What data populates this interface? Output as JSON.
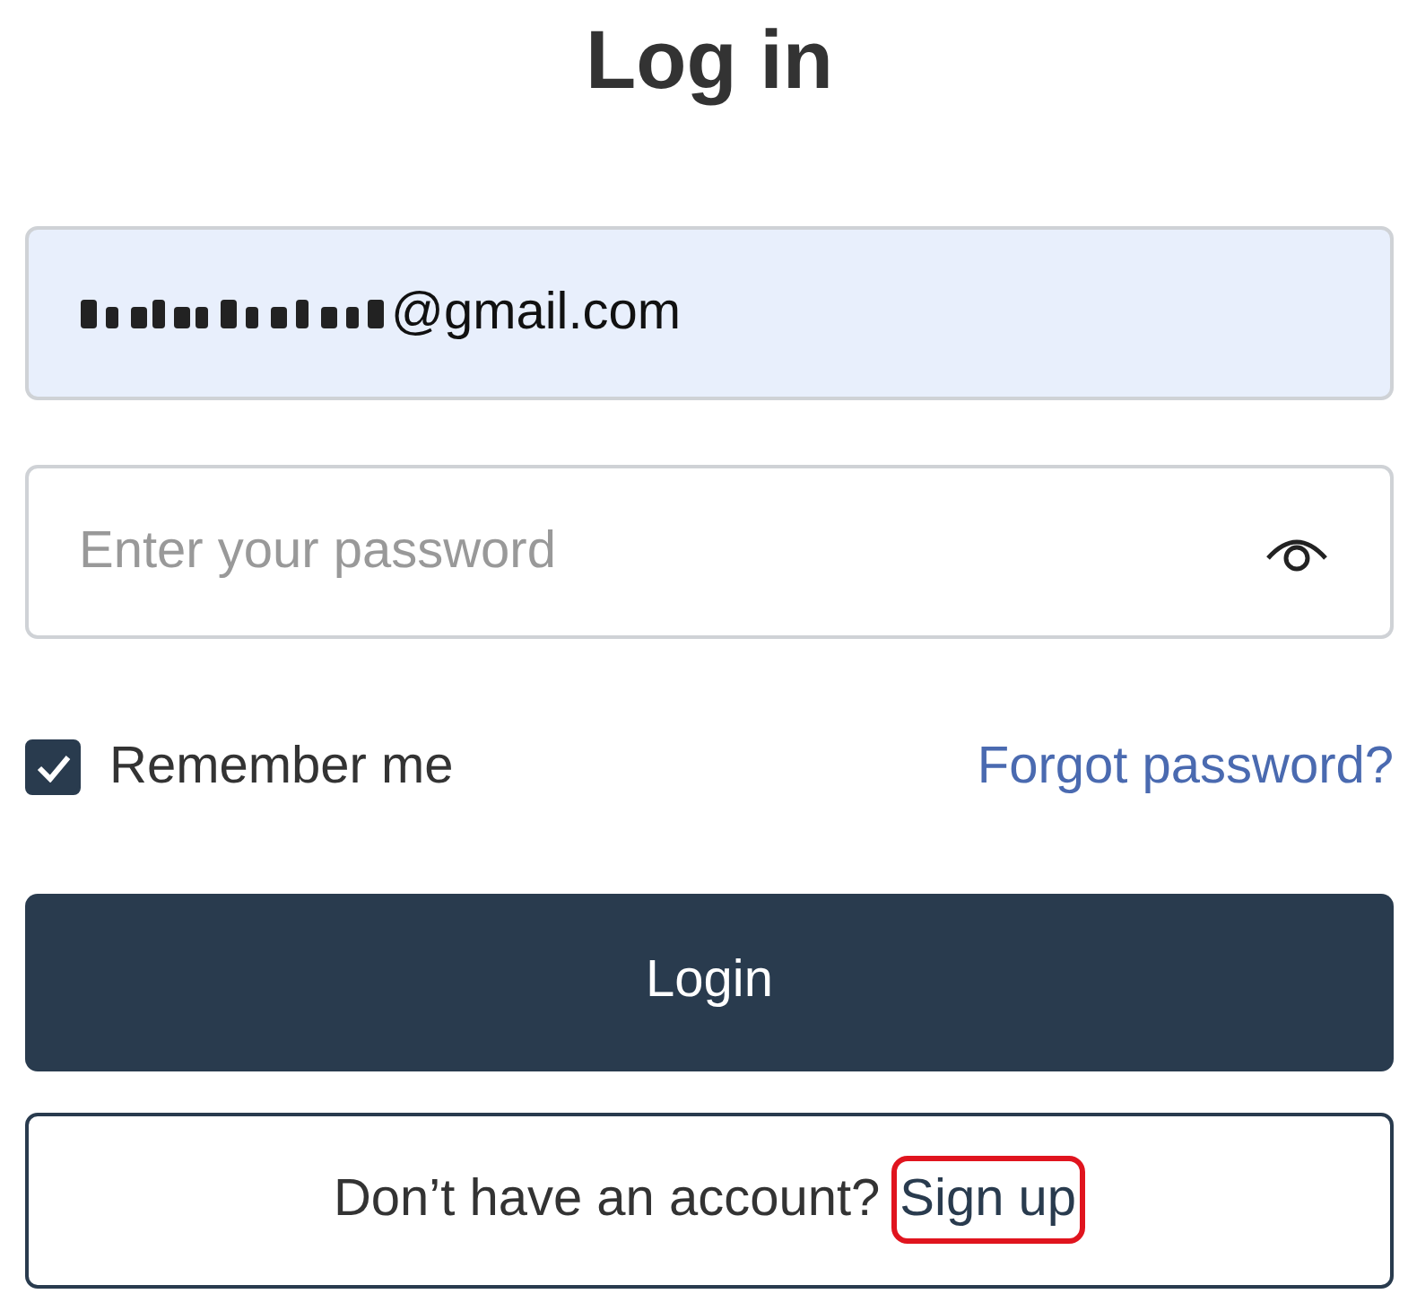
{
  "title": "Log in",
  "email": {
    "value": "@gmail.com",
    "redacted": true,
    "autofilled": true
  },
  "password": {
    "placeholder": "Enter your password"
  },
  "remember": {
    "label": "Remember me",
    "checked": true
  },
  "forgot_link": "Forgot password?",
  "login_button": "Login",
  "signup": {
    "prompt": "Don’t have an account?",
    "link": "Sign up",
    "highlighted": true
  }
}
